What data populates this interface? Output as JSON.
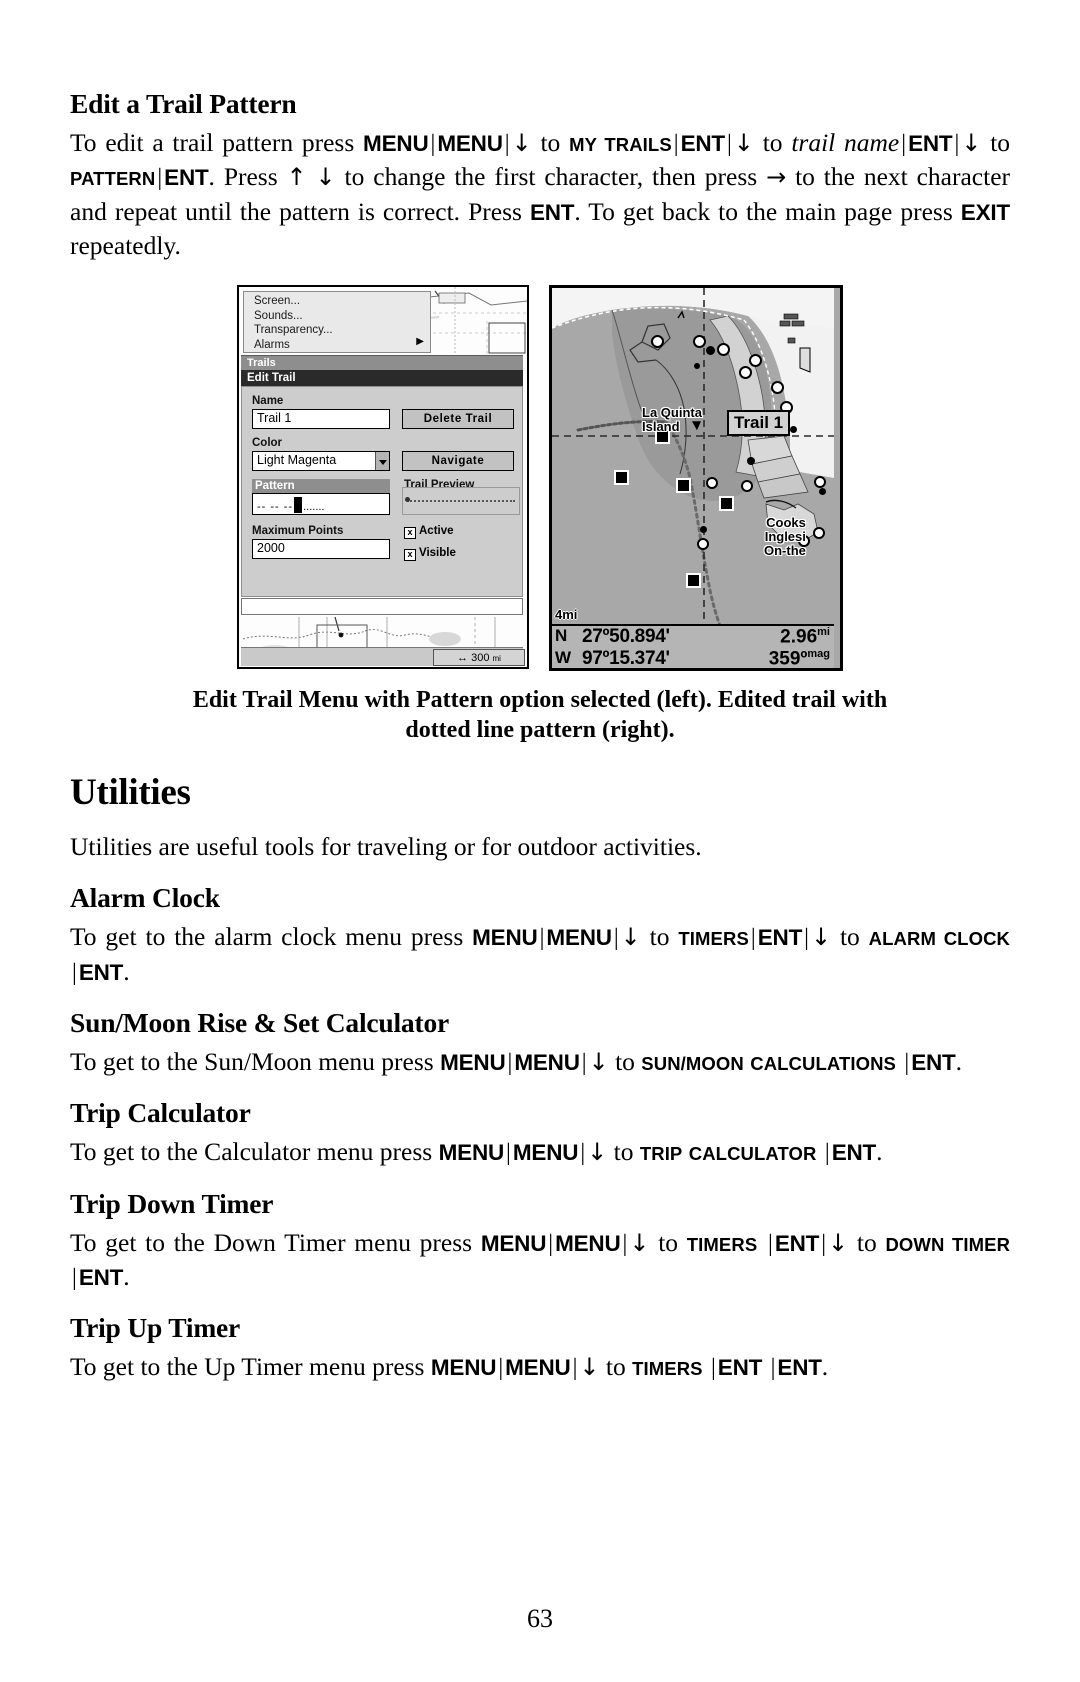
{
  "section1": {
    "heading": "Edit a Trail Pattern",
    "p1_a": "To edit a trail pattern press ",
    "k_menu": "MENU",
    "k_ent": "ENT",
    "k_exit": "EXIT",
    "sc_mytrails": "My Trails",
    "it_trailname": "trail name",
    "sc_pattern": "Pattern",
    "p1_b": " to change the first character, then press ",
    "p1_c": " to the next character and repeat until the pattern is correct. Press ",
    "p1_d": ". To get back to the main page press ",
    "p1_e": " repeatedly.",
    "to": "to",
    "press": "Press"
  },
  "figure": {
    "left": {
      "menu_items": [
        "Screen...",
        "Sounds...",
        "Transparency...",
        "Alarms"
      ],
      "trails_bar": "Trails",
      "edit_bar": "Edit Trail",
      "name_label": "Name",
      "name_value": "Trail 1",
      "delete_button": "Delete Trail",
      "color_label": "Color",
      "color_value": "Light Magenta",
      "navigate_button": "Navigate",
      "pattern_label": "Pattern",
      "pattern_value": "-- -- --",
      "preview_label": "Trail Preview",
      "max_points_label": "Maximum Points",
      "max_points_value": "2000",
      "active_label": "Active",
      "visible_label": "Visible",
      "checkmark": "x",
      "scale_arrow": "↔",
      "scale_value": "300",
      "scale_unit": "mi"
    },
    "right": {
      "trail_label": "Trail 1",
      "place_line1": "La Quinta",
      "place_line2": "Island",
      "place2_line1": "Cooks",
      "place2_line2": "Inglesi",
      "place2_line3": "On-the",
      "scale": "4mi",
      "lat_hemi": "N",
      "lat_value": "27º50.894'",
      "lon_hemi": "W",
      "lon_value": "97º15.374'",
      "dist_value": "2.96",
      "dist_unit": "mi",
      "bearing_value": "359º",
      "bearing_unit": "mag"
    },
    "caption_line1": "Edit Trail Menu with Pattern option selected (left). Edited trail with",
    "caption_line2": "dotted line pattern (right)."
  },
  "utilities": {
    "heading": "Utilities",
    "intro": "Utilities are useful tools for traveling or for outdoor activities."
  },
  "alarm_clock": {
    "heading": "Alarm Clock",
    "a": "To get to the alarm clock menu press ",
    "sc_timers": "Timers",
    "sc_alarmclock": "Alarm Clock",
    "to": "to"
  },
  "sunmoon": {
    "heading": "Sun/Moon Rise & Set Calculator",
    "a": "To get to the Sun/Moon menu press ",
    "sc_sunmoon": "Sun/Moon",
    "sc_calculations": "Calculations",
    "to": "to"
  },
  "trip_calc": {
    "heading": "Trip Calculator",
    "a": "To get to the Calculator menu press ",
    "sc_trip": "Trip",
    "sc_calculator": "Calculator",
    "to": "to"
  },
  "trip_down": {
    "heading": "Trip Down Timer",
    "a": "To get to the Down Timer menu press ",
    "sc_timers": "Timers",
    "sc_downtimer": "Down Timer",
    "to": "to"
  },
  "trip_up": {
    "heading": "Trip Up Timer",
    "a": "To get to the Up Timer menu press ",
    "sc_timers": "Timers",
    "to": "to"
  },
  "keys": {
    "menu": "MENU",
    "ent": "ENT",
    "exit": "EXIT",
    "sep": "|",
    "down": "↓",
    "up": "↑",
    "right": "→"
  },
  "footer": {
    "page_number": "63"
  }
}
